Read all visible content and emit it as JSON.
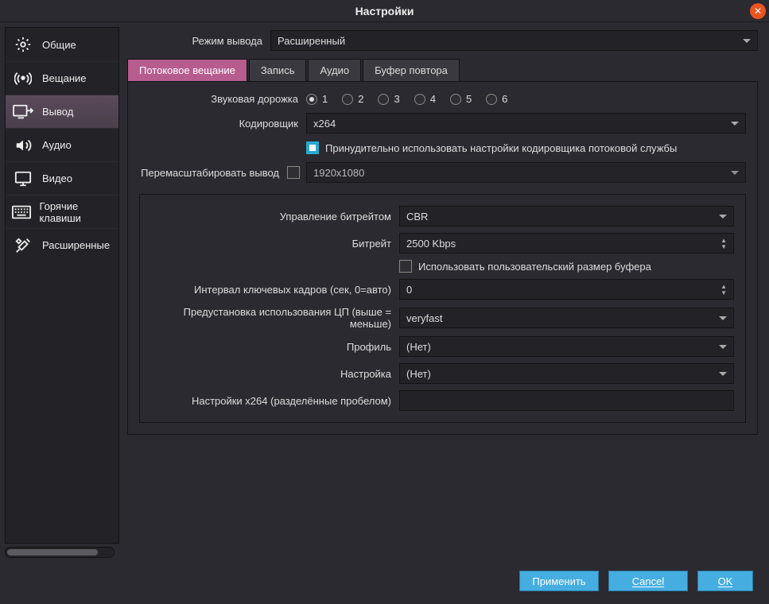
{
  "window": {
    "title": "Настройки"
  },
  "sidebar": {
    "items": [
      {
        "label": "Общие"
      },
      {
        "label": "Вещание"
      },
      {
        "label": "Вывод"
      },
      {
        "label": "Аудио"
      },
      {
        "label": "Видео"
      },
      {
        "label": "Горячие клавиши"
      },
      {
        "label": "Расширенные"
      }
    ]
  },
  "output_mode": {
    "label": "Режим вывода",
    "value": "Расширенный"
  },
  "tabs": [
    {
      "label": "Потоковое вещание"
    },
    {
      "label": "Запись"
    },
    {
      "label": "Аудио"
    },
    {
      "label": "Буфер повтора"
    }
  ],
  "stream": {
    "audio_track_label": "Звуковая дорожка",
    "tracks": [
      "1",
      "2",
      "3",
      "4",
      "5",
      "6"
    ],
    "encoder_label": "Кодировщик",
    "encoder_value": "x264",
    "enforce_label": "Принудительно использовать настройки кодировщика потоковой службы",
    "rescale_label": "Перемасштабировать вывод",
    "rescale_value": "1920x1080"
  },
  "enc": {
    "rate_control_label": "Управление битрейтом",
    "rate_control_value": "CBR",
    "bitrate_label": "Битрейт",
    "bitrate_value": "2500 Kbps",
    "custom_buf_label": "Использовать пользовательский размер буфера",
    "keyint_label": "Интервал ключевых кадров (сек, 0=авто)",
    "keyint_value": "0",
    "preset_label": "Предустановка использования ЦП (выше = меньше)",
    "preset_value": "veryfast",
    "profile_label": "Профиль",
    "profile_value": "(Нет)",
    "tune_label": "Настройка",
    "tune_value": "(Нет)",
    "x264opts_label": "Настройки x264 (разделённые пробелом)"
  },
  "footer": {
    "apply": "Применить",
    "cancel": "Cancel",
    "ok": "OK"
  }
}
